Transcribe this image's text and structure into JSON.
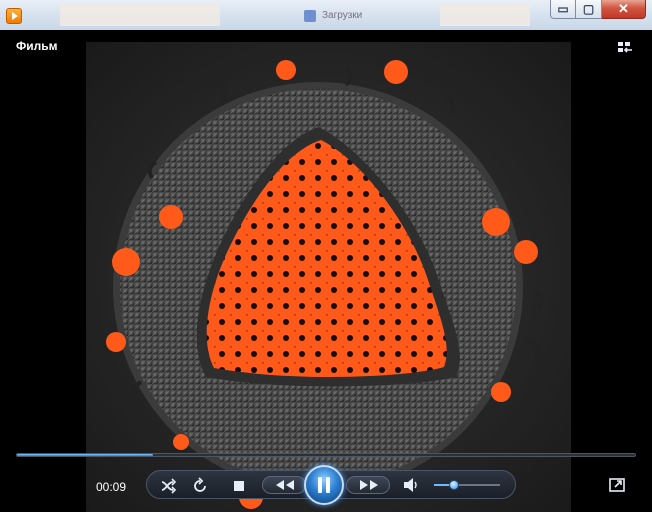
{
  "window": {
    "title_bar": {
      "background_task": "Загрузки",
      "minimize_glyph": "▭",
      "maximize_glyph": "▢",
      "close_glyph": "✕"
    }
  },
  "player": {
    "movie_title": "Фильм",
    "current_time": "00:09",
    "progress_fraction": 0.22,
    "volume_fraction": 0.3,
    "controls": {
      "shuffle_icon": "shuffle-icon",
      "repeat_icon": "repeat-icon",
      "stop_icon": "stop-icon",
      "previous_icon": "rewind-icon",
      "pause_icon": "pause-icon",
      "next_icon": "fast-forward-icon",
      "volume_icon": "speaker-icon",
      "fullscreen_icon": "fullscreen-icon",
      "switch_to_library_icon": "switch-to-library-icon"
    }
  },
  "colors": {
    "virus_core": "#ff5a1a",
    "virus_shell": "#4a4a4a",
    "accent_blue": "#2d7fd1"
  }
}
